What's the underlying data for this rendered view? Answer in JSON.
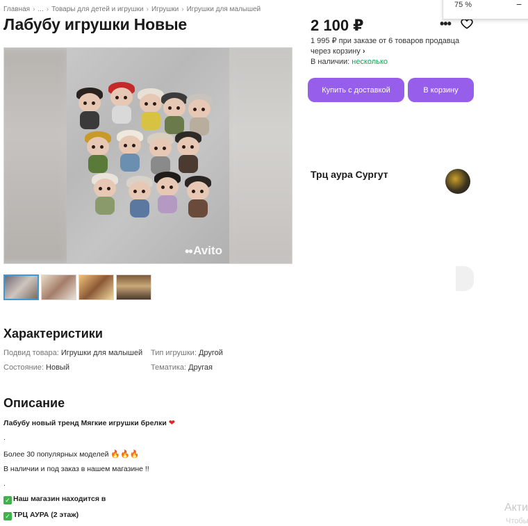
{
  "breadcrumbs": [
    "Главная",
    "...",
    "Товары для детей и игрушки",
    "Игрушки",
    "Игрушки для малышей"
  ],
  "breadcrumb_separator": "›",
  "title": "Лабубу игрушки Новые",
  "gallery": {
    "watermark": "Avito",
    "thumbnail_count": 4
  },
  "price": {
    "value": "2 100 ₽",
    "note": "1 995 ₽ при заказе от 6 товаров продавца через корзину",
    "note_arrow": "›",
    "availability_label": "В наличии:",
    "availability_value": "несколько"
  },
  "actions": {
    "buy_label": "Купить с доставкой",
    "cart_label": "В корзину",
    "more_icon": "more-icon",
    "favorite_icon": "heart-icon"
  },
  "seller": {
    "name": "Трц аура Сургут"
  },
  "zoom": {
    "value": "75 %",
    "minus": "−"
  },
  "characteristics": {
    "title": "Характеристики",
    "items": [
      {
        "key": "Подвид товара:",
        "value": "Игрушки для малышей"
      },
      {
        "key": "Тип игрушки:",
        "value": "Другой"
      },
      {
        "key": "Состояние:",
        "value": "Новый"
      },
      {
        "key": "Тематика:",
        "value": "Другая"
      }
    ]
  },
  "description": {
    "title": "Описание",
    "line1": "Лабубу новый тренд Мягкие игрушки брелки",
    "dot1": ".",
    "line2": "Более 30 популярных моделей",
    "line3": "В наличии и под заказ в нашем магазине !!",
    "dot2": ".",
    "line4": "Наш магазин находится в",
    "line5": "ТРЦ АУРА (2 этаж)"
  },
  "os_overlay": {
    "text": "Акти",
    "sub": "Чтобы"
  },
  "colors": {
    "accent": "#965eeb",
    "available": "#13a452",
    "thumb_active": "#3d9ad6"
  }
}
